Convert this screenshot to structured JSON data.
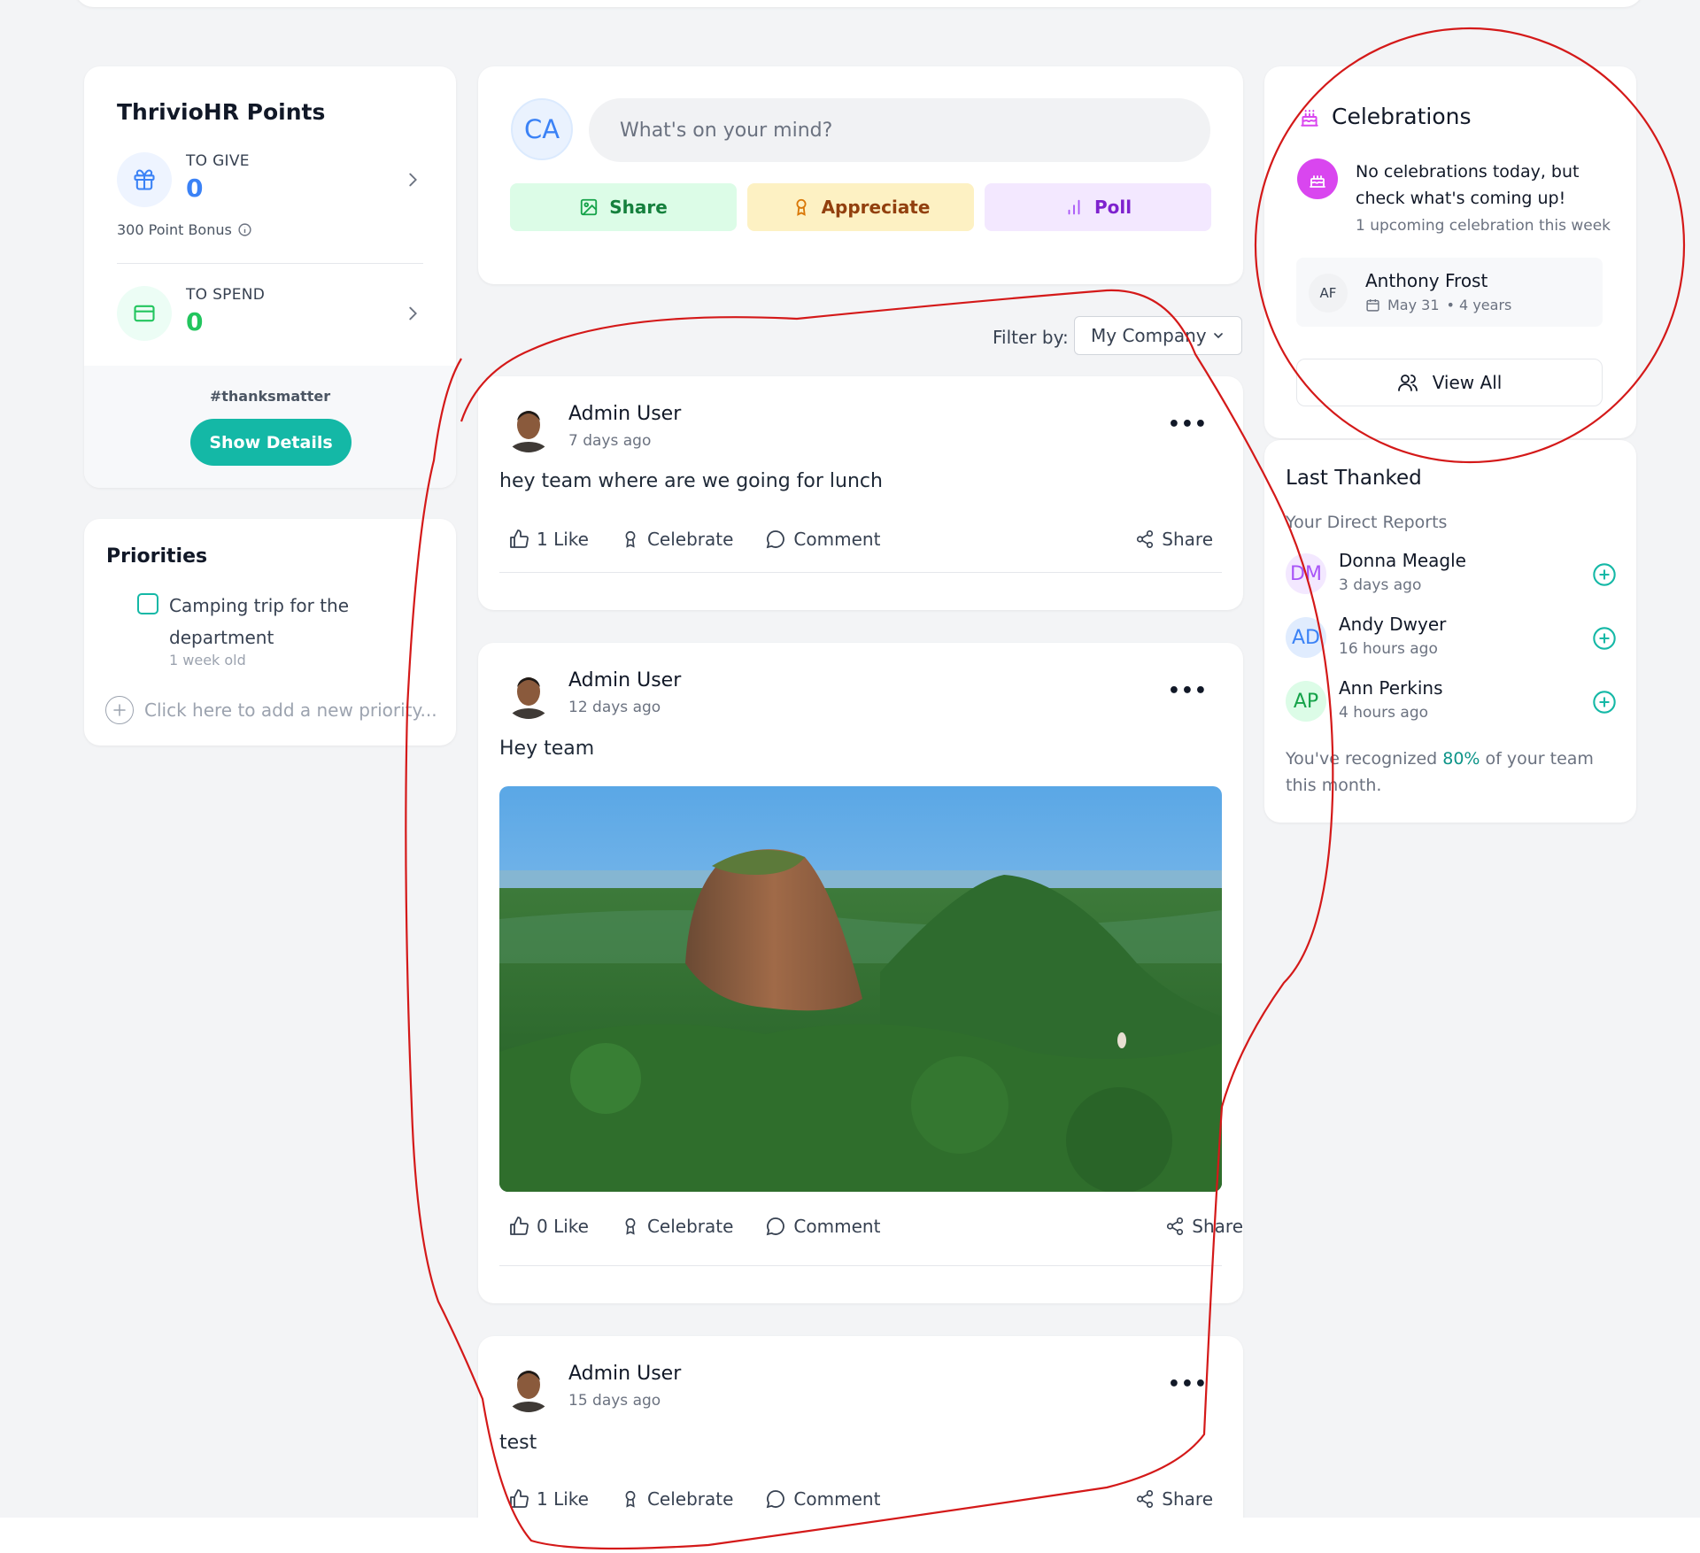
{
  "points": {
    "title": "ThrivioHR Points",
    "to_give_label": "TO GIVE",
    "to_give_value": "0",
    "bonus": "300 Point Bonus",
    "to_spend_label": "TO SPEND",
    "to_spend_value": "0",
    "hashtag": "#thanksmatter",
    "show_details": "Show Details"
  },
  "priorities": {
    "title": "Priorities",
    "items": [
      {
        "text": "Camping trip for the department",
        "age": "1 week old"
      }
    ],
    "add_placeholder": "Click here to add a new priority..."
  },
  "composer": {
    "avatar": "CA",
    "placeholder": "What's on your mind?",
    "share": "Share",
    "appreciate": "Appreciate",
    "poll": "Poll"
  },
  "filter": {
    "label": "Filter by:",
    "value": "My Company"
  },
  "posts": [
    {
      "author": "Admin User",
      "time": "7 days ago",
      "text": "hey team where are we going for lunch",
      "likes": "1 Like",
      "celebrate": "Celebrate",
      "comment": "Comment",
      "share": "Share"
    },
    {
      "author": "Admin User",
      "time": "12 days ago",
      "text": "Hey team",
      "likes": "0 Like",
      "celebrate": "Celebrate",
      "comment": "Comment",
      "share": "Share"
    },
    {
      "author": "Admin User",
      "time": "15 days ago",
      "text": "test",
      "likes": "1 Like",
      "celebrate": "Celebrate",
      "comment": "Comment",
      "share": "Share"
    }
  ],
  "celebrations": {
    "title": "Celebrations",
    "message": "No celebrations today, but check what's coming up!",
    "sub": "1 upcoming celebration this week",
    "person": {
      "initials": "AF",
      "name": "Anthony Frost",
      "date": "May 31",
      "years": "• 4 years"
    },
    "view_all": "View All"
  },
  "last_thanked": {
    "title": "Last Thanked",
    "subtitle": "Your Direct Reports",
    "people": [
      {
        "initials": "DM",
        "name": "Donna Meagle",
        "time": "3 days ago"
      },
      {
        "initials": "AD",
        "name": "Andy Dwyer",
        "time": "16 hours ago"
      },
      {
        "initials": "AP",
        "name": "Ann Perkins",
        "time": "4 hours ago"
      }
    ],
    "summary_pre": "You've recognized ",
    "summary_pct": "80%",
    "summary_post": " of your team this month."
  },
  "colors": {
    "accent": "#14b8a6",
    "annotation": "#d41919"
  }
}
